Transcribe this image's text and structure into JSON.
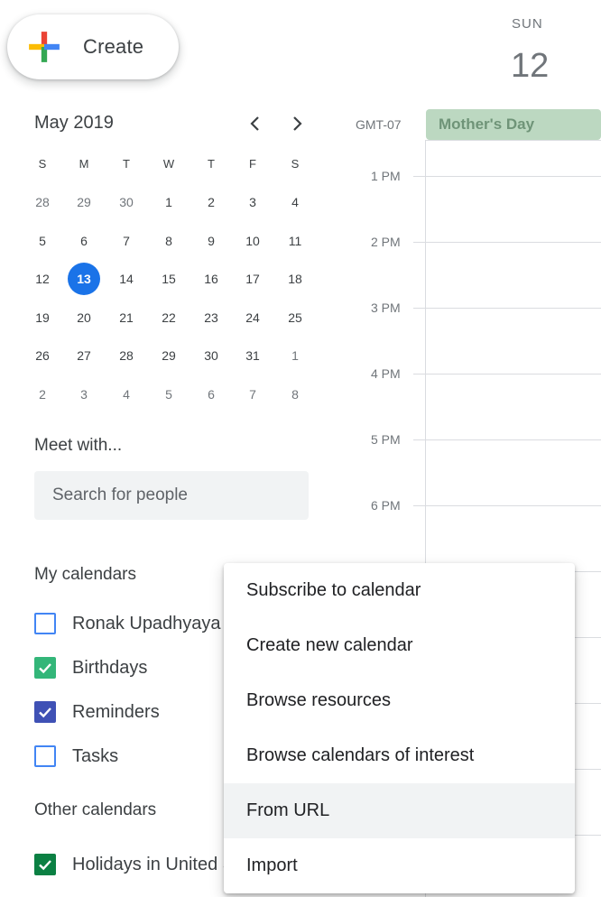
{
  "create": {
    "label": "Create"
  },
  "mini_calendar": {
    "title": "May 2019",
    "weekdays": [
      "S",
      "M",
      "T",
      "W",
      "T",
      "F",
      "S"
    ],
    "weeks": [
      [
        "28",
        "29",
        "30",
        "1",
        "2",
        "3",
        "4"
      ],
      [
        "5",
        "6",
        "7",
        "8",
        "9",
        "10",
        "11"
      ],
      [
        "12",
        "13",
        "14",
        "15",
        "16",
        "17",
        "18"
      ],
      [
        "19",
        "20",
        "21",
        "22",
        "23",
        "24",
        "25"
      ],
      [
        "26",
        "27",
        "28",
        "29",
        "30",
        "31",
        "1"
      ],
      [
        "2",
        "3",
        "4",
        "5",
        "6",
        "7",
        "8"
      ]
    ],
    "selected": "13"
  },
  "meet_with": {
    "title": "Meet with...",
    "placeholder": "Search for people"
  },
  "my_calendars": {
    "title": "My calendars",
    "items": [
      {
        "label": "Ronak Upadhyaya",
        "checked": false,
        "color": "#4285f4"
      },
      {
        "label": "Birthdays",
        "checked": true,
        "color": "#33b679"
      },
      {
        "label": "Reminders",
        "checked": true,
        "color": "#3f51b5"
      },
      {
        "label": "Tasks",
        "checked": false,
        "color": "#4285f4"
      }
    ]
  },
  "other_calendars": {
    "title": "Other calendars",
    "items": [
      {
        "label": "Holidays in United States",
        "checked": true,
        "color": "#0b8043"
      }
    ]
  },
  "day_view": {
    "day_name": "SUN",
    "day_number": "12",
    "timezone": "GMT-07",
    "all_day_event": "Mother's Day",
    "hours": [
      "1 PM",
      "2 PM",
      "3 PM",
      "4 PM",
      "5 PM",
      "6 PM"
    ]
  },
  "menu": {
    "items": [
      "Subscribe to calendar",
      "Create new calendar",
      "Browse resources",
      "Browse calendars of interest",
      "From URL",
      "Import"
    ],
    "hovered": "From URL"
  },
  "colors": {
    "accent": "#1a73e8",
    "event_bg": "#bcd8c1",
    "event_text": "#6f9478"
  }
}
